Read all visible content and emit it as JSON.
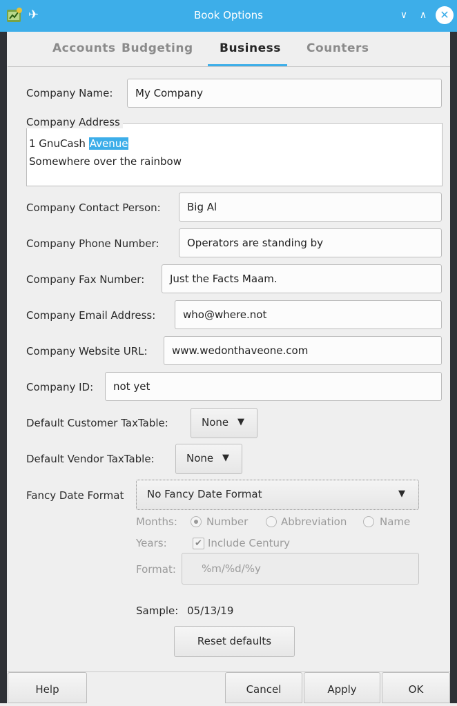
{
  "window": {
    "title": "Book Options",
    "controls": {
      "minimize": "∨",
      "maximize": "∧",
      "close": "✕"
    },
    "accent": "#3daee9"
  },
  "tabs": [
    {
      "label": "Accounts"
    },
    {
      "label": "Budgeting"
    },
    {
      "label": "Business",
      "active": true
    },
    {
      "label": "Counters"
    }
  ],
  "company": {
    "name_label": "Company Name:",
    "name_value": "My Company",
    "address_label": "Company Address",
    "address_line1_a": "1 GnuCash ",
    "address_line1_sel": "Avenue",
    "address_line2": "Somewhere over the rainbow",
    "contact_label": "Company Contact Person:",
    "contact_value": "Big Al",
    "phone_label": "Company Phone Number:",
    "phone_value": "Operators are standing by",
    "fax_label": "Company Fax Number:",
    "fax_value": "Just the Facts Maam.",
    "email_label": "Company Email Address:",
    "email_value": "who@where.not",
    "website_label": "Company Website URL:",
    "website_value": "www.wedonthaveone.com",
    "id_label": "Company ID:",
    "id_value": "not yet"
  },
  "tax": {
    "customer_label": "Default Customer TaxTable:",
    "customer_value": "None",
    "vendor_label": "Default Vendor TaxTable:",
    "vendor_value": "None"
  },
  "date_format": {
    "label": "Fancy Date Format",
    "value": "No Fancy Date Format",
    "months_label": "Months:",
    "months_options": [
      "Number",
      "Abbreviation",
      "Name"
    ],
    "months_selected": "Number",
    "years_label": "Years:",
    "include_century_label": "Include Century",
    "include_century_checked": true,
    "format_label": "Format:",
    "format_value": "%m/%d/%y",
    "sample_label": "Sample:",
    "sample_value": "05/13/19",
    "reset_label": "Reset defaults"
  },
  "buttons": {
    "help": "Help",
    "cancel": "Cancel",
    "apply": "Apply",
    "ok": "OK"
  }
}
